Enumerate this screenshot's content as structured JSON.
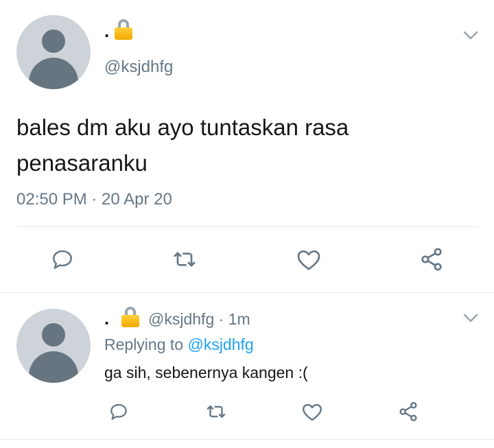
{
  "main_tweet": {
    "display_name": ".",
    "handle": "@ksjdhfg",
    "text": "bales dm aku ayo tuntaskan rasa penasaranku",
    "timestamp": "02:50 PM · 20 Apr 20",
    "protected_icon": "lock-icon",
    "menu_icon": "chevron-down-icon",
    "actions": [
      "reply-icon",
      "retweet-icon",
      "like-icon",
      "share-icon"
    ]
  },
  "reply_tweet": {
    "display_name": ".",
    "handle": "@ksjdhfg",
    "separator": "·",
    "time_ago": "1m",
    "replying_label": "Replying to",
    "replying_to": "@ksjdhfg",
    "text": "ga sih, sebenernya kangen :(",
    "protected_icon": "lock-icon",
    "menu_icon": "chevron-down-icon",
    "actions": [
      "reply-icon",
      "retweet-icon",
      "like-icon",
      "share-icon"
    ]
  },
  "colors": {
    "text_primary": "#14171a",
    "text_secondary": "#657786",
    "link": "#1da1f2",
    "divider": "#e1e8ed",
    "avatar_bg": "#cdd3d8",
    "avatar_fg": "#66757f",
    "lock": "#f2a900"
  }
}
